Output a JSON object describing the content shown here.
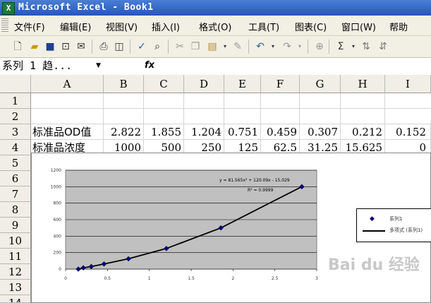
{
  "titlebar": {
    "icon": "excel-icon",
    "title": "Microsoft Excel - Book1"
  },
  "menu": [
    "文件(F)",
    "编辑(E)",
    "视图(V)",
    "插入(I)",
    "格式(O)",
    "工具(T)",
    "图表(C)",
    "窗口(W)",
    "帮助"
  ],
  "toolbar": {
    "icons": [
      "new-icon",
      "open-icon",
      "save-icon",
      "permission-icon",
      "print-icon",
      "print-preview-icon",
      "spelling-icon",
      "research-icon",
      "cut-icon",
      "copy-icon",
      "paste-icon",
      "format-painter-icon",
      "undo-icon",
      "redo-icon",
      "hyperlink-icon",
      "autosum-icon",
      "sort-ascending-icon"
    ],
    "sigma": "Σ"
  },
  "formula_bar": {
    "name_box": "系列 1 趋...",
    "fx": "fx",
    "content": ""
  },
  "sheet": {
    "columns": [
      "A",
      "B",
      "C",
      "D",
      "E",
      "F",
      "G",
      "H",
      "I"
    ],
    "rows": [
      "1",
      "2",
      "3",
      "4",
      "5",
      "6",
      "7",
      "8",
      "9",
      "10",
      "11",
      "12",
      "13",
      "14"
    ],
    "row3": {
      "label": "标准品OD值",
      "values": [
        "2.822",
        "1.855",
        "1.204",
        "0.751",
        "0.459",
        "0.307",
        "0.212",
        "0.152"
      ]
    },
    "row4": {
      "label": "标准品浓度",
      "values": [
        "1000",
        "500",
        "250",
        "125",
        "62.5",
        "31.25",
        "15.625",
        "0"
      ]
    }
  },
  "chart_data": {
    "type": "scatter",
    "x": [
      0.152,
      0.212,
      0.307,
      0.459,
      0.751,
      1.204,
      1.855,
      2.822
    ],
    "series": [
      {
        "name": "系列1",
        "values": [
          0,
          15.625,
          31.25,
          62.5,
          125,
          250,
          500,
          1000
        ]
      }
    ],
    "trendline": {
      "name": "多项式 (系列1)",
      "equation": "y = 81.565x² + 120.09x - 15.029",
      "r2": "R² = 0.9999"
    },
    "ylim": [
      0,
      1200
    ],
    "xlim": [
      0,
      3
    ],
    "yticks": [
      "0",
      "200",
      "400",
      "600",
      "800",
      "1000",
      "1200"
    ],
    "xticks": [
      "0",
      "0.5",
      "1",
      "1.5",
      "2",
      "2.5",
      "3"
    ],
    "grid": true,
    "legend_placement": "right",
    "colors": {
      "plot_bg": "#c0c0c0",
      "marker": "#000080",
      "line": "#000000"
    }
  },
  "watermark": "Bai du 经验"
}
